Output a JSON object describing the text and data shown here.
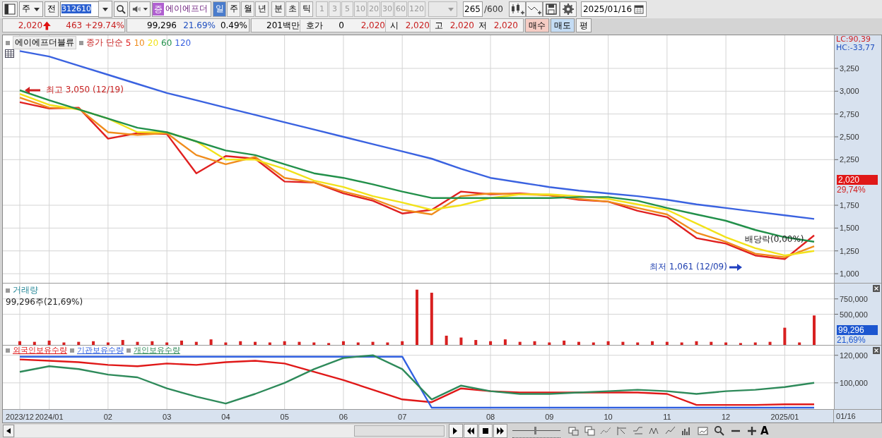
{
  "toolbar": {
    "market_select": "주",
    "mode_button": "전",
    "code": "312610",
    "market_badge": "증",
    "stock_name": "에이에프더",
    "periods": [
      {
        "label": "일",
        "selected": true
      },
      {
        "label": "주",
        "selected": false
      },
      {
        "label": "월",
        "selected": false
      },
      {
        "label": "년",
        "selected": false
      },
      {
        "label": "분",
        "selected": false
      },
      {
        "label": "초",
        "selected": false
      },
      {
        "label": "틱",
        "selected": false
      }
    ],
    "intervals": [
      "1",
      "3",
      "5",
      "10",
      "20",
      "30",
      "60",
      "120"
    ],
    "count": "265",
    "count_max": "/600",
    "date": "2025/01/16"
  },
  "quote": {
    "price": "2,020",
    "rising": true,
    "change": "463",
    "change_rate": "+29.74%",
    "volume": "99,296",
    "volume_rate": "21.69%",
    "turnover_rate": "0.49%",
    "amount": "201백만",
    "bid_label": "호가",
    "bid_qty": "0",
    "bid_price": "2,020",
    "open_label": "시",
    "open": "2,020",
    "high_label": "고",
    "high": "2,020",
    "low_label": "저",
    "low": "2,020",
    "buttons": [
      {
        "label": "매수",
        "kind": "buy"
      },
      {
        "label": "매도",
        "kind": "sell"
      },
      {
        "label": "평",
        "kind": "plain"
      }
    ]
  },
  "price_pane": {
    "legend": {
      "stock": "에이에프더블류",
      "ma_label": "종가 단순"
    },
    "axis_header": [
      {
        "text": "LC:90,39",
        "color": "#d02020"
      },
      {
        "text": "HC:-33,77",
        "color": "#2050c0"
      }
    ],
    "labels": [
      {
        "kind": "high",
        "text": "최고 3,050 (12/19)"
      },
      {
        "kind": "low",
        "text": "최저 1,061 (12/09)"
      },
      {
        "kind": "event",
        "text": "배당락(0,00%)"
      }
    ],
    "marker": {
      "value": "2,020",
      "change": "29,74%"
    },
    "chart_data": {
      "type": "line",
      "grid": true,
      "ylim": [
        900,
        3613
      ],
      "yticks": [
        {
          "value": 1000,
          "label": "1,000"
        },
        {
          "value": 1250,
          "label": "1,250"
        },
        {
          "value": 1500,
          "label": "1,500"
        },
        {
          "value": 1750,
          "label": "1,750"
        },
        {
          "value": 2250,
          "label": "2,250"
        },
        {
          "value": 2500,
          "label": "2,500"
        },
        {
          "value": 2750,
          "label": "2,750"
        },
        {
          "value": 3000,
          "label": "3,000"
        },
        {
          "value": 3250,
          "label": "3,250"
        }
      ],
      "series": [
        {
          "name": "5",
          "color": "#e02020",
          "values": [
            2880,
            2810,
            2820,
            2480,
            2540,
            2530,
            2100,
            2290,
            2260,
            2010,
            2000,
            1880,
            1800,
            1660,
            1700,
            1900,
            1870,
            1880,
            1860,
            1810,
            1790,
            1690,
            1620,
            1390,
            1330,
            1200,
            1160,
            1420
          ]
        },
        {
          "name": "10",
          "color": "#f08c1c",
          "values": [
            2930,
            2820,
            2810,
            2550,
            2520,
            2540,
            2300,
            2200,
            2280,
            2050,
            2000,
            1900,
            1820,
            1700,
            1650,
            1850,
            1880,
            1870,
            1860,
            1820,
            1790,
            1720,
            1650,
            1450,
            1350,
            1220,
            1180,
            1300
          ]
        },
        {
          "name": "20",
          "color": "#f2e21a",
          "values": [
            2970,
            2850,
            2800,
            2700,
            2550,
            2550,
            2450,
            2250,
            2250,
            2150,
            2020,
            1950,
            1850,
            1780,
            1700,
            1750,
            1830,
            1870,
            1870,
            1850,
            1820,
            1760,
            1700,
            1550,
            1400,
            1280,
            1200,
            1250
          ]
        },
        {
          "name": "60",
          "color": "#22904a",
          "values": [
            3010,
            2900,
            2800,
            2700,
            2600,
            2550,
            2450,
            2350,
            2300,
            2200,
            2100,
            2050,
            1980,
            1900,
            1830,
            1830,
            1830,
            1830,
            1830,
            1840,
            1840,
            1800,
            1720,
            1650,
            1580,
            1480,
            1400,
            1350
          ]
        },
        {
          "name": "120",
          "color": "#3a62e0",
          "values": [
            3440,
            3380,
            3280,
            3180,
            3080,
            2980,
            2900,
            2820,
            2740,
            2660,
            2580,
            2500,
            2420,
            2340,
            2260,
            2150,
            2050,
            2000,
            1950,
            1910,
            1880,
            1850,
            1810,
            1760,
            1720,
            1680,
            1640,
            1600
          ]
        }
      ]
    }
  },
  "volume_pane": {
    "info": "99,296주(21,69%)",
    "marker": {
      "value": "99,296",
      "change": "21,69%"
    },
    "chart_data": {
      "type": "bar",
      "grid": true,
      "ylim": [
        0,
        1000000
      ],
      "yticks": [
        {
          "value": 500000,
          "label": "500,000"
        },
        {
          "value": 750000,
          "label": "750,000"
        }
      ],
      "series": [
        {
          "name": "거래량",
          "color": "#d82020",
          "values": [
            60000,
            50000,
            70000,
            40000,
            50000,
            60000,
            40000,
            80000,
            50000,
            60000,
            40000,
            70000,
            50000,
            90000,
            40000,
            60000,
            50000,
            40000,
            60000,
            50000,
            40000,
            30000,
            60000,
            40000,
            50000,
            40000,
            60000,
            900000,
            850000,
            150000,
            120000,
            80000,
            60000,
            90000,
            50000,
            60000,
            40000,
            70000,
            50000,
            40000,
            60000,
            50000,
            40000,
            60000,
            50000,
            40000,
            60000,
            50000,
            40000,
            30000,
            40000,
            50000,
            280000,
            40000,
            480000
          ]
        }
      ]
    }
  },
  "holdings_pane": {
    "end_date": "01/16",
    "chart_data": {
      "type": "line",
      "grid": true,
      "categories": [
        "2023/12",
        "2024/01",
        null,
        "02",
        null,
        "03",
        null,
        "04",
        null,
        "05",
        null,
        "06",
        null,
        "07",
        null,
        null,
        "08",
        null,
        "09",
        null,
        "10",
        null,
        "11",
        null,
        "12",
        null,
        "2025/01",
        null
      ],
      "ylim": [
        81000,
        127000
      ],
      "yticks": [
        {
          "value": 100000,
          "label": "100,000"
        },
        {
          "value": 120000,
          "label": "120,000"
        }
      ],
      "series": [
        {
          "name": "외국인보유수량",
          "color": "#e01818",
          "values": [
            117000,
            116000,
            115000,
            113000,
            112000,
            114000,
            113000,
            115000,
            116000,
            114000,
            108000,
            102000,
            95000,
            88000,
            86000,
            96000,
            94000,
            93000,
            93000,
            93000,
            93000,
            93000,
            92000,
            84000,
            84000,
            84000,
            84500,
            84500
          ]
        },
        {
          "name": "기관보유수량",
          "color": "#3060e0",
          "values": [
            119000,
            119000,
            119000,
            119000,
            119000,
            119000,
            119000,
            119000,
            119000,
            119000,
            119000,
            119000,
            119000,
            119000,
            82000,
            82000,
            82000,
            82000,
            82000,
            82000,
            82000,
            82000,
            82000,
            82000,
            82000,
            82000,
            82000,
            82000
          ]
        },
        {
          "name": "개인보유수량",
          "color": "#2e8a5a",
          "values": [
            108000,
            112000,
            110000,
            106000,
            104000,
            96000,
            90000,
            85000,
            92000,
            100000,
            110000,
            118000,
            120000,
            110000,
            88000,
            98000,
            94000,
            92000,
            92000,
            93000,
            94000,
            95000,
            94000,
            92000,
            94000,
            95000,
            97000,
            100000
          ]
        }
      ]
    }
  },
  "bottom_bar": {
    "zoom_slider": {
      "level": 0.47
    },
    "font_button": "A"
  }
}
